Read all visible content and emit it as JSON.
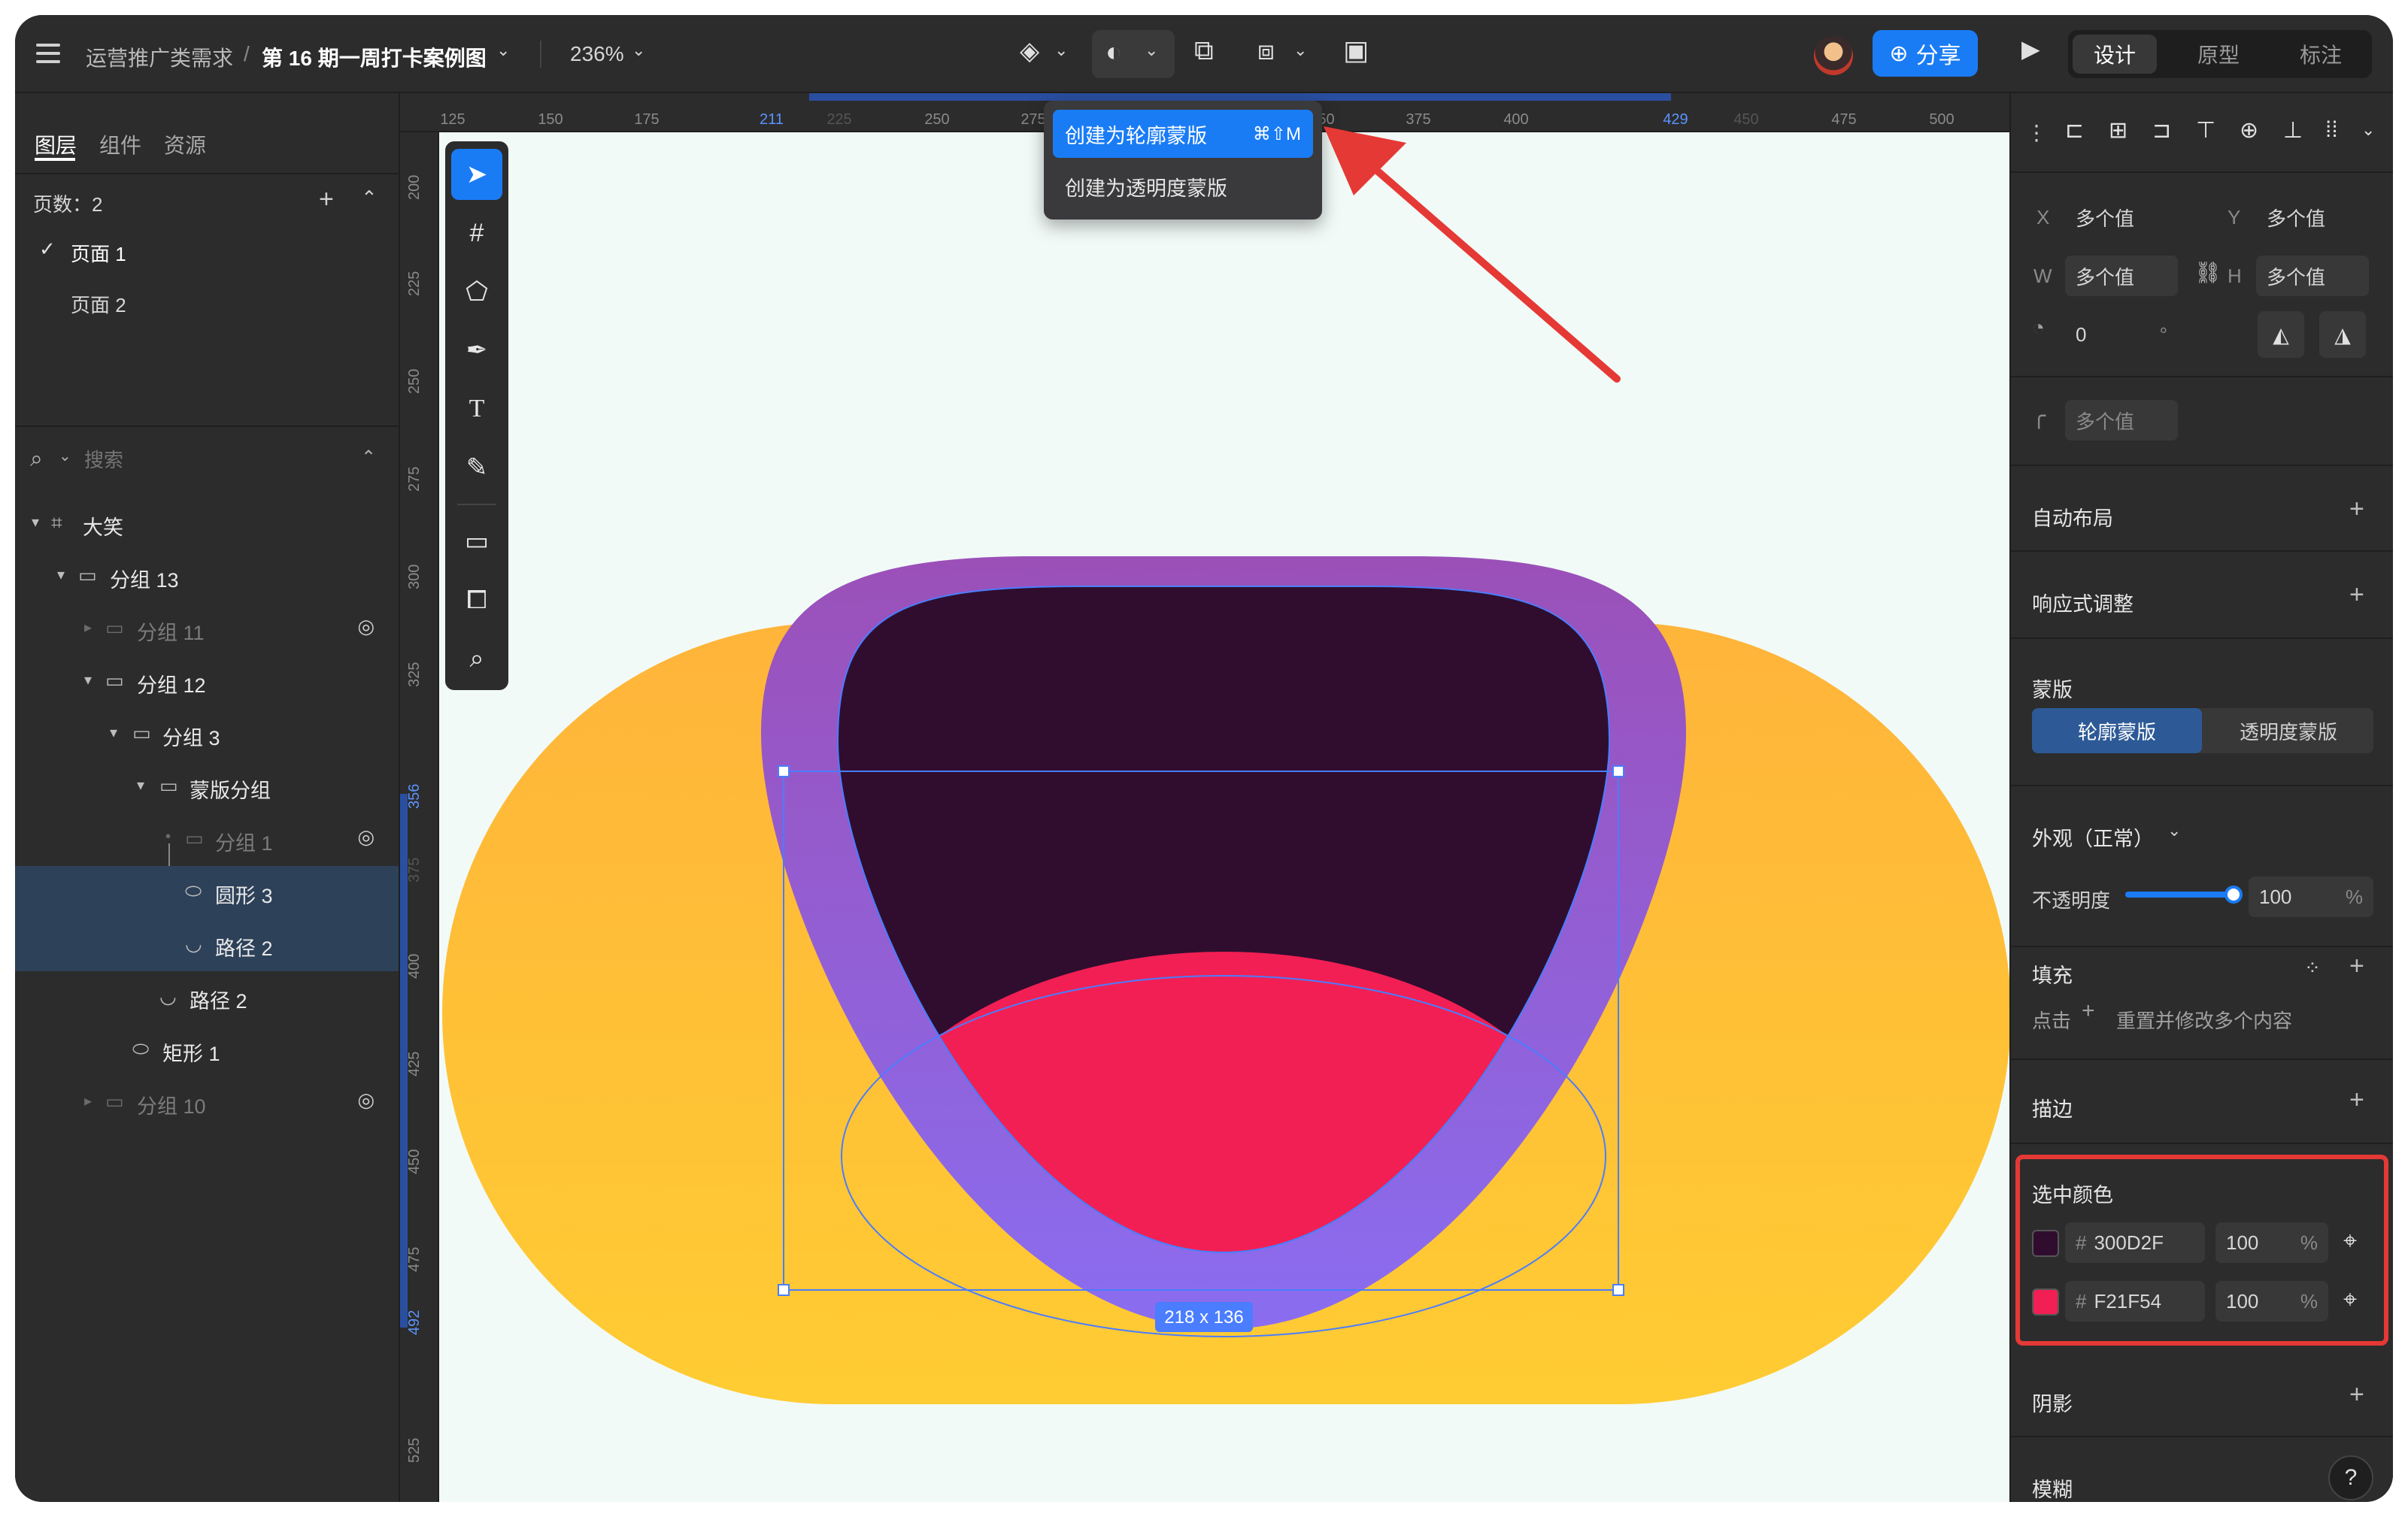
{
  "topbar": {
    "breadcrumb_project": "运营推广类需求",
    "breadcrumb_sep": "/",
    "breadcrumb_file": "第 16 期一周打卡案例图",
    "zoom": "236%",
    "share_label": "分享",
    "modes": [
      "设计",
      "原型",
      "标注"
    ],
    "active_mode": "设计"
  },
  "dropdown": {
    "item1": "创建为轮廓蒙版",
    "item1_shortcut": "⌘⇧M",
    "item2": "创建为透明度蒙版"
  },
  "left": {
    "tabs": [
      "图层",
      "组件",
      "资源"
    ],
    "pages_label": "页数：2",
    "pages": [
      "页面 1",
      "页面 2"
    ],
    "search_placeholder": "搜索",
    "layers": [
      {
        "label": "大笑",
        "icon": "frame-icon"
      },
      {
        "label": "分组 13",
        "icon": "folder-icon"
      },
      {
        "label": "分组 11",
        "icon": "folder-icon",
        "hidden": true
      },
      {
        "label": "分组 12",
        "icon": "folder-icon"
      },
      {
        "label": "分组 3",
        "icon": "folder-icon"
      },
      {
        "label": "蒙版分组",
        "icon": "folder-icon"
      },
      {
        "label": "分组 1",
        "icon": "folder-icon",
        "hidden": true
      },
      {
        "label": "圆形 3",
        "icon": "ellipse-icon",
        "selected": true
      },
      {
        "label": "路径 2",
        "icon": "path-icon",
        "selected": true
      },
      {
        "label": "路径 2",
        "icon": "path-icon"
      },
      {
        "label": "矩形 1",
        "icon": "rectangle-icon"
      },
      {
        "label": "分组 10",
        "icon": "folder-icon",
        "hidden": true
      }
    ]
  },
  "rulers": {
    "h_ticks": [
      "125",
      "150",
      "175",
      "211",
      "225",
      "250",
      "275",
      "350",
      "375",
      "400",
      "429",
      "450",
      "475",
      "500",
      "5"
    ],
    "v_ticks": [
      "200",
      "225",
      "250",
      "275",
      "300",
      "325",
      "356",
      "375",
      "400",
      "425",
      "450",
      "475",
      "492",
      "525"
    ]
  },
  "canvas": {
    "selection_size": "218 x 136"
  },
  "right": {
    "x_label": "X",
    "x_value": "多个值",
    "y_label": "Y",
    "y_value": "多个值",
    "w_label": "W",
    "w_value": "多个值",
    "h_label": "H",
    "h_value": "多个值",
    "rotation_value": "0",
    "rotation_unit": "°",
    "radius_value": "多个值",
    "auto_layout": "自动布局",
    "responsive": "响应式调整",
    "mask_title": "蒙版",
    "mask_outline": "轮廓蒙版",
    "mask_opacity": "透明度蒙版",
    "appearance": "外观（正常）",
    "opacity_label": "不透明度",
    "opacity_value": "100",
    "opacity_level": 1.0,
    "percent": "%",
    "fill_title": "填充",
    "fill_hint_click": "点击",
    "fill_hint_rest": "重置并修改多个内容",
    "stroke_title": "描边",
    "selected_colors_title": "选中颜色",
    "hash": "#",
    "colors": [
      {
        "hex": "300D2F",
        "opacity": "100",
        "swatch": "#300D2F"
      },
      {
        "hex": "F21F54",
        "opacity": "100",
        "swatch": "#F21F54"
      }
    ],
    "shadow_title": "阴影",
    "blur_title": "模糊",
    "help": "?"
  },
  "colors": {
    "accent": "#1a7cf5",
    "annotation_red": "#e53935",
    "face_orange": "#ffc035",
    "mouth_purple": "#8b6ae8",
    "mouth_dark": "#300D2F",
    "tongue": "#F21F54"
  }
}
